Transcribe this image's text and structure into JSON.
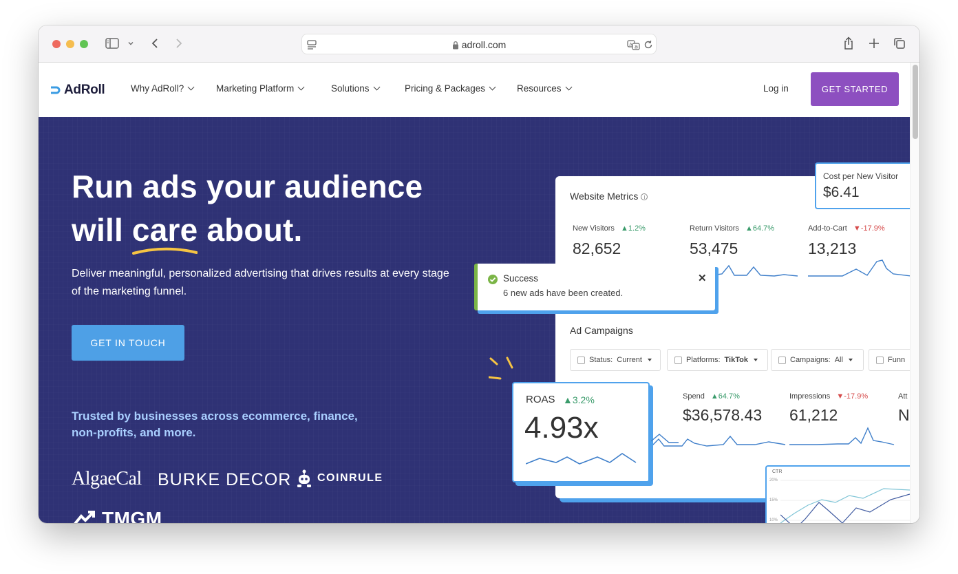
{
  "browser": {
    "url": "adroll.com"
  },
  "nav": {
    "logo_text": "AdRoll",
    "items": [
      {
        "label": "Why AdRoll?"
      },
      {
        "label": "Marketing Platform"
      },
      {
        "label": "Solutions"
      },
      {
        "label": "Pricing & Packages"
      },
      {
        "label": "Resources"
      }
    ],
    "login": "Log in",
    "cta": "GET STARTED"
  },
  "hero": {
    "headline_line1": "Run ads your audience",
    "headline_will": "will",
    "headline_care": "care",
    "headline_about": "about.",
    "subhead": "Deliver meaningful, personalized advertising that drives results at every stage of the marketing funnel.",
    "cta": "GET IN TOUCH",
    "trusted": "Trusted by businesses across ecommerce, finance, non-profits, and more.",
    "brands": [
      "AlgaeCal",
      "BURKE DECOR",
      "COINRULE",
      "TMGM"
    ]
  },
  "dashboard": {
    "metrics_title": "Website Metrics",
    "metrics": [
      {
        "label": "New Visitors",
        "delta": "1.2%",
        "direction": "up",
        "value": "82,652"
      },
      {
        "label": "Return Visitors",
        "delta": "64.7%",
        "direction": "up",
        "value": "53,475"
      },
      {
        "label": "Add-to-Cart",
        "delta": "-17.9%",
        "direction": "down",
        "value": "13,213"
      }
    ],
    "cost_card": {
      "label": "Cost per New Visitor",
      "value": "$6.41"
    },
    "success": {
      "title": "Success",
      "message": "6 new ads have been created."
    },
    "campaigns_title": "Ad Campaigns",
    "filters": [
      {
        "label": "Status:",
        "value": "Current"
      },
      {
        "label": "Platforms:",
        "value": "TikTok"
      },
      {
        "label": "Campaigns:",
        "value": "All"
      },
      {
        "label": "Funn",
        "value": ""
      }
    ],
    "campaign_metrics": [
      {
        "label": "Spend",
        "delta": "64.7%",
        "direction": "up",
        "value": "$36,578.43"
      },
      {
        "label": "Impressions",
        "delta": "-17.9%",
        "direction": "down",
        "value": "61,212"
      },
      {
        "label": "Att",
        "delta": "",
        "direction": "",
        "value": "N"
      }
    ],
    "roas": {
      "label": "ROAS",
      "delta": "3.2%",
      "value": "4.93x"
    },
    "ctr": {
      "label": "CTR",
      "ticks": [
        "20%",
        "15%",
        "10%"
      ]
    }
  },
  "colors": {
    "hero_bg": "#2f3275",
    "cta_purple": "#8d4fc0",
    "cta_blue": "#4ea0e6",
    "accent_blue": "#4fa2ec",
    "success_green": "#7bb547",
    "trusted_text": "#a9cfff",
    "underline_yellow": "#f6c443"
  }
}
